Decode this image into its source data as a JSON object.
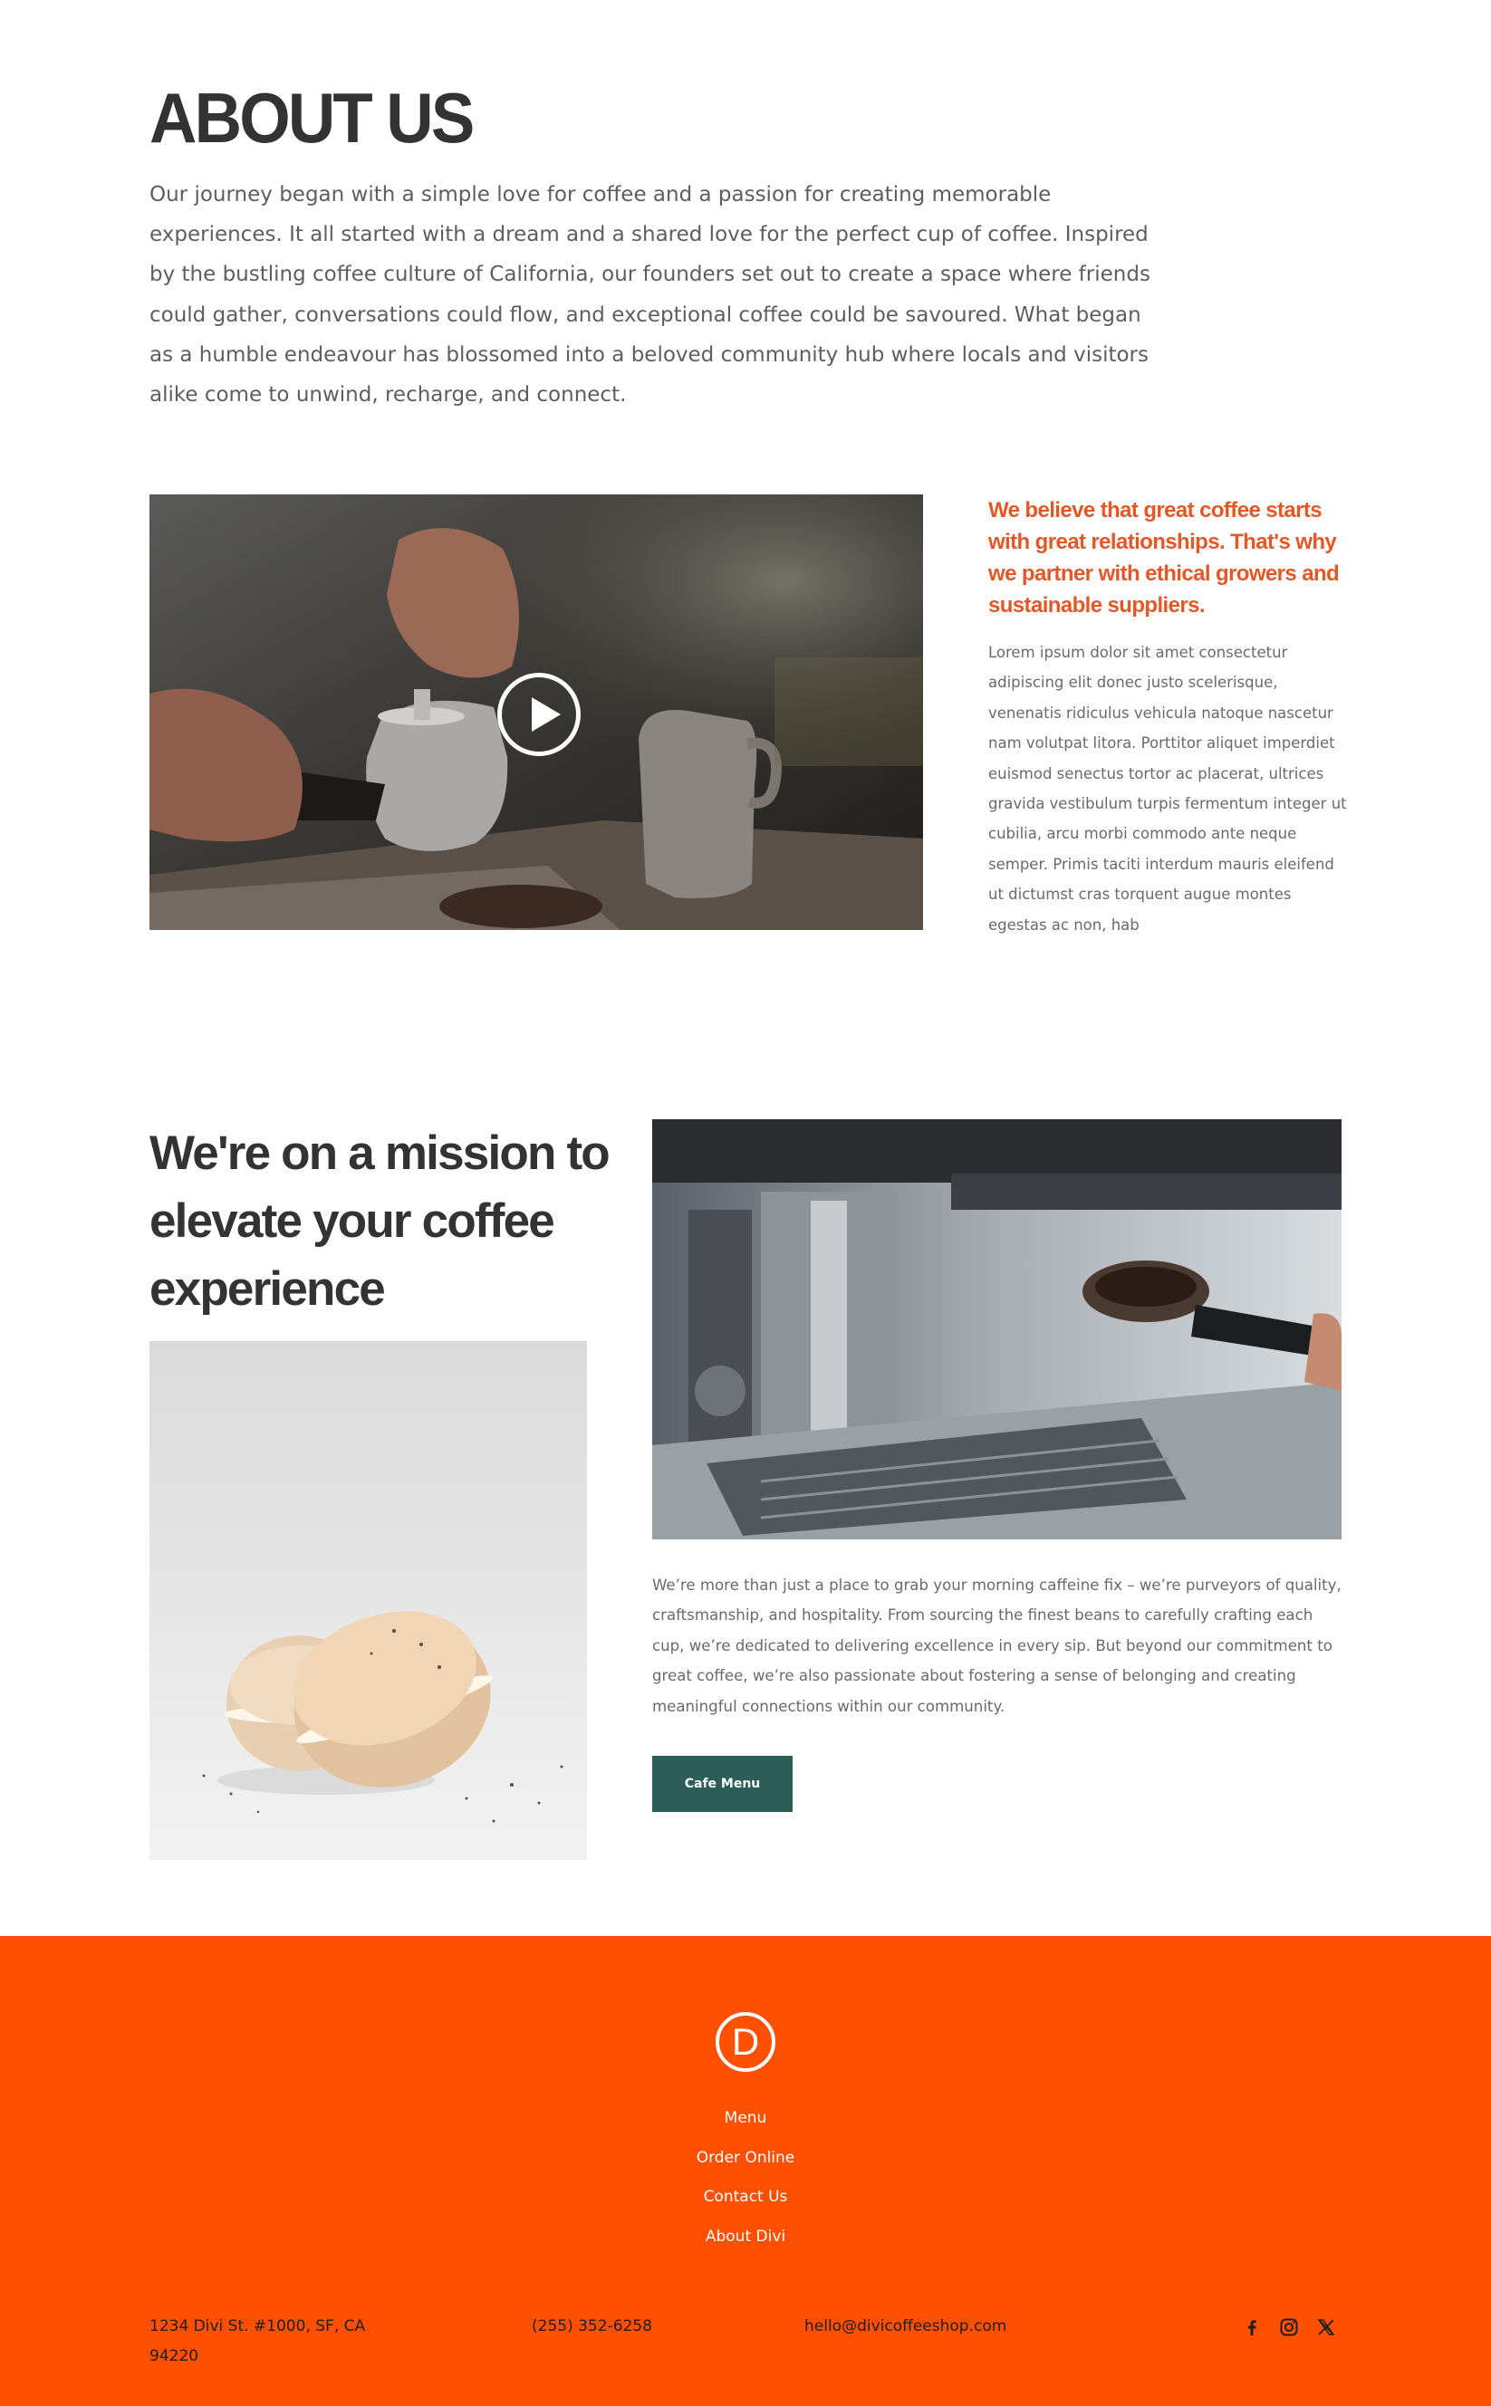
{
  "about": {
    "title": "ABOUT US",
    "intro": "Our journey began with a simple love for coffee and a passion for creating memorable experiences. It all started with a dream and a shared love for the perfect cup of coffee. Inspired by the bustling coffee culture of California, our founders set out to create a space where friends could gather, conversations could flow, and exceptional coffee could be savoured. What began as a humble endeavour has blossomed into a beloved community hub where locals and visitors alike come to unwind, recharge, and connect."
  },
  "video": {
    "play_icon": "play-circle-icon"
  },
  "belief": {
    "heading": "We believe that great coffee starts with great relationships. That's why we partner with ethical growers and sustainable suppliers.",
    "body": "Lorem ipsum dolor sit amet consectetur adipiscing elit donec justo scelerisque, venenatis ridiculus vehicula natoque nascetur nam volutpat litora. Porttitor aliquet imperdiet euismod senectus tortor ac placerat, ultrices gravida vestibulum turpis fermentum integer ut cubilia, arcu morbi commodo ante neque semper. Primis taciti interdum mauris eleifend ut dictumst cras torquent augue montes egestas ac non, hab"
  },
  "mission": {
    "heading": "We're on a mission to elevate your coffee experience",
    "body": "We’re more than just a place to grab your morning caffeine fix – we’re purveyors of quality, craftsmanship, and hospitality. From sourcing the finest beans to carefully crafting each cup, we’re dedicated to delivering excellence in every sip. But beyond our commitment to great coffee, we’re also passionate about fostering a sense of belonging and creating meaningful connections within our community.",
    "button_label": "Cafe Menu"
  },
  "footer": {
    "logo_letter": "D",
    "nav": [
      "Menu",
      "Order Online",
      "Contact Us",
      "About Divi"
    ],
    "address": "1234 Divi St. #1000, SF, CA 94220",
    "phone": "(255) 352-6258",
    "email": "hello@divicoffeeshop.com",
    "social_icons": [
      "facebook-icon",
      "instagram-icon",
      "x-twitter-icon"
    ]
  },
  "colors": {
    "accent_orange": "#e35826",
    "footer_background": "#ff4f00",
    "button_green": "#2d5d57",
    "heading_dark": "#333333"
  }
}
